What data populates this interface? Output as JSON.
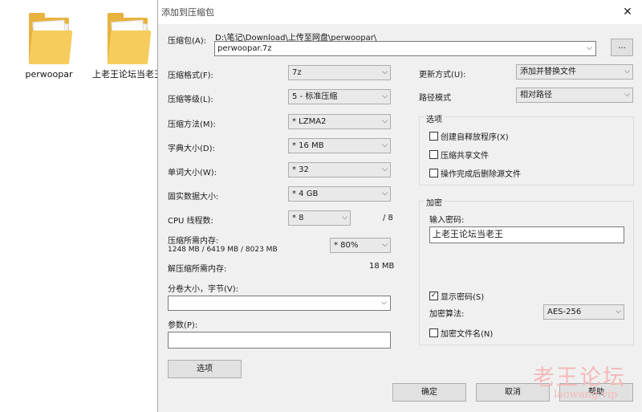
{
  "desktop": {
    "icons": [
      {
        "label": "perwoopar"
      },
      {
        "label": "上老王论坛当老王"
      }
    ]
  },
  "dialog": {
    "title": "添加到压缩包",
    "close_glyph": "✕",
    "archive_label": "压缩包(A):",
    "archive_path": "D:\\笔记\\Download\\上传至网盘\\perwoopar\\",
    "archive_name": "perwoopar.7z",
    "browse_label": "...",
    "left": {
      "format": {
        "label": "压缩格式(F):",
        "value": "7z"
      },
      "level": {
        "label": "压缩等级(L):",
        "value": "5 - 标准压缩"
      },
      "method": {
        "label": "压缩方法(M):",
        "value": "* LZMA2"
      },
      "dict": {
        "label": "字典大小(D):",
        "value": "* 16 MB"
      },
      "word": {
        "label": "单词大小(W):",
        "value": "* 32"
      },
      "solid": {
        "label": "固实数据大小:",
        "value": "* 4 GB"
      },
      "threads": {
        "label": "CPU 线程数:",
        "value": "* 8",
        "max": "/ 8"
      },
      "mem_compress": {
        "label": "压缩所需内存:",
        "detail": "1248 MB / 6419 MB / 8023 MB",
        "value": "* 80%"
      },
      "mem_decompress": {
        "label": "解压缩所需内存:",
        "value": "18 MB"
      },
      "split": {
        "label": "分卷大小，字节(V):",
        "value": ""
      },
      "params": {
        "label": "参数(P):",
        "value": ""
      },
      "options_button": "选项"
    },
    "right": {
      "update": {
        "label": "更新方式(U):",
        "value": "添加并替换文件"
      },
      "path_mode": {
        "label": "路径模式",
        "value": "相对路径"
      },
      "options_group": {
        "title": "选项",
        "sfx": {
          "label": "创建自释放程序(X)",
          "checked": false
        },
        "shared": {
          "label": "压缩共享文件",
          "checked": false
        },
        "delete": {
          "label": "操作完成后删除源文件",
          "checked": false
        }
      },
      "encryption": {
        "title": "加密",
        "password_label": "输入密码:",
        "password_value": "上老王论坛当老王",
        "show_password": {
          "label": "显示密码(S)",
          "checked": true
        },
        "method_label": "加密算法:",
        "method_value": "AES-256",
        "encrypt_names": {
          "label": "加密文件名(N)",
          "checked": false
        }
      }
    },
    "buttons": {
      "ok": "确定",
      "cancel": "取消",
      "help": "帮助"
    }
  },
  "watermark": {
    "line1": "老王论坛",
    "line2": "laowang.vip"
  },
  "glyphs": {
    "chevron": "⌵",
    "check": "✓"
  }
}
